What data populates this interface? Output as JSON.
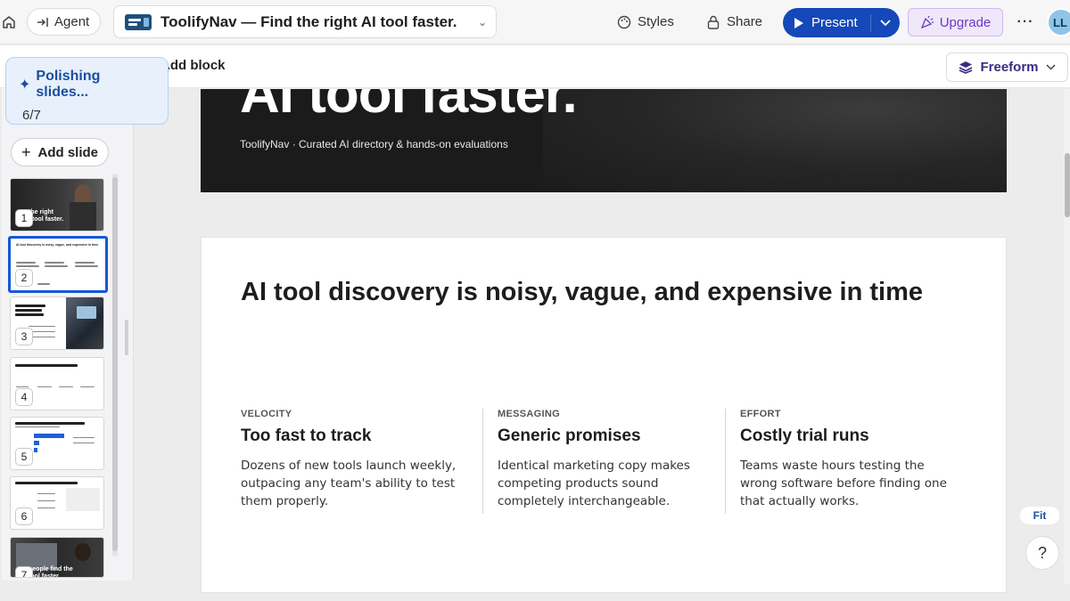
{
  "topbar": {
    "agent_label": "Agent",
    "doc_title": "ToolifyNav — Find the right AI tool faster.",
    "styles_label": "Styles",
    "share_label": "Share",
    "present_label": "Present",
    "upgrade_label": "Upgrade",
    "more_label": "···",
    "avatar_initials": "LL"
  },
  "toolbar": {
    "add_block_label": "Add block",
    "freeform_label": "Freeform"
  },
  "toast": {
    "title": "Polishing slides...",
    "progress": "6/7"
  },
  "sidebar": {
    "add_slide_label": "Add slide",
    "thumbnails": [
      {
        "num": "1",
        "text": "the right\nl tool faster."
      },
      {
        "num": "2",
        "text": "AI tool discovery is noisy, vague, and expensive in time"
      },
      {
        "num": "3",
        "text": "ToolifyNav turns a crowded market into shortlist you can trust"
      },
      {
        "num": "4",
        "text": "Use it to say, then connect to the tool that fits"
      },
      {
        "num": "5",
        "text": "Building a directory with free reach and paid visibility"
      },
      {
        "num": "6",
        "text": "List your tool where serious buyers are already looking"
      },
      {
        "num": "7",
        "text": "people find the\ntool faster"
      }
    ]
  },
  "slide1": {
    "title": "AI tool faster.",
    "subtitle": "ToolifyNav · Curated AI directory & hands-on evaluations"
  },
  "slide2": {
    "title": "AI tool discovery is noisy, vague, and expensive in time",
    "columns": [
      {
        "label": "VELOCITY",
        "heading": "Too fast to track",
        "body": "Dozens of new tools launch weekly, outpacing any team's ability to test them properly."
      },
      {
        "label": "MESSAGING",
        "heading": "Generic promises",
        "body": "Identical marketing copy makes competing products sound completely interchangeable."
      },
      {
        "label": "EFFORT",
        "heading": "Costly trial runs",
        "body": "Teams waste hours testing the wrong software before finding one that actually works."
      }
    ]
  },
  "controls": {
    "fit_label": "Fit",
    "help_label": "?"
  },
  "colors": {
    "accent": "#1548b8",
    "upgrade": "#6a3cc0",
    "selected_thumb": "#1557d6"
  }
}
